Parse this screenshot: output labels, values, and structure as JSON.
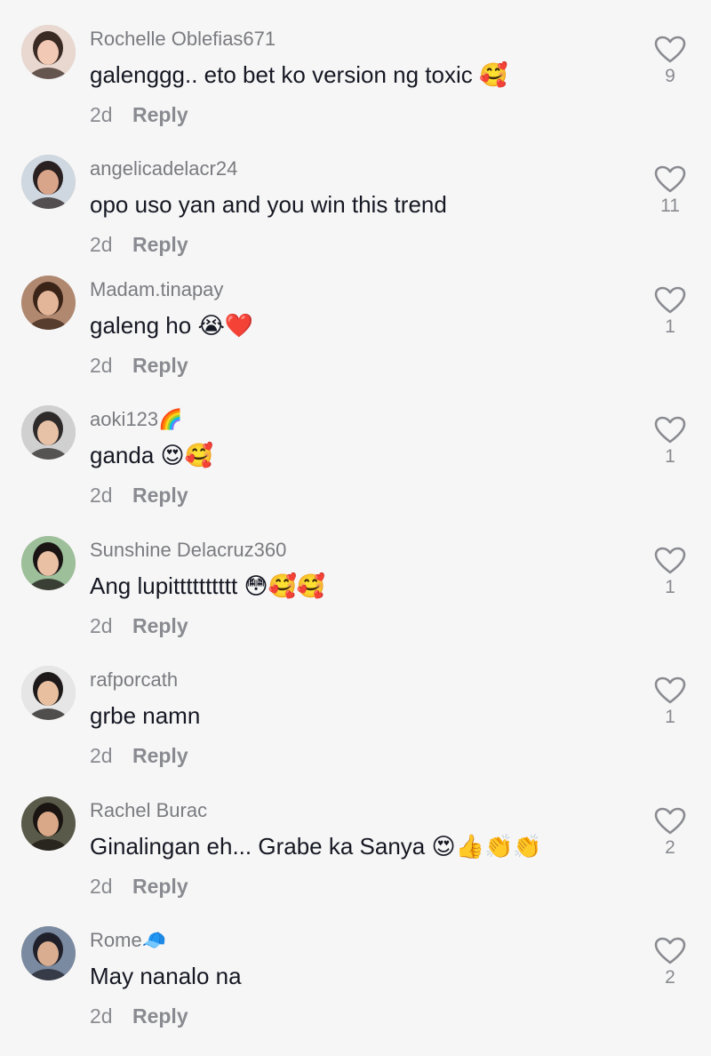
{
  "comments": [
    {
      "username": "Rochelle Oblefias671",
      "username_emoji": "",
      "text": "galenggg.. eto bet ko version ng toxic",
      "emojis": "🥰",
      "time": "2d",
      "reply": "Reply",
      "likes": "9",
      "avatar_colors": [
        "#e8d8d0",
        "#3a2a24",
        "#f1c9b4"
      ]
    },
    {
      "username": "angelicadelacr24",
      "username_emoji": "",
      "text": "opo uso yan and you win this trend",
      "emojis": "",
      "time": "2d",
      "reply": "Reply",
      "likes": "11",
      "avatar_colors": [
        "#cfd8e0",
        "#2a2020",
        "#d9a58a"
      ]
    },
    {
      "username": "Madam.tinapay",
      "username_emoji": "",
      "text": "galeng ho",
      "emojis": "😭❤️",
      "time": "2d",
      "reply": "Reply",
      "likes": "1",
      "avatar_colors": [
        "#b08870",
        "#3a2418",
        "#e3b69a"
      ]
    },
    {
      "username": "aoki123",
      "username_emoji": "🌈",
      "text": "ganda",
      "emojis": "😍🥰",
      "time": "2d",
      "reply": "Reply",
      "likes": "1",
      "avatar_colors": [
        "#d0d0d0",
        "#2e2a2a",
        "#e8c2a6"
      ]
    },
    {
      "username": "Sunshine Delacruz360",
      "username_emoji": "",
      "text": "Ang lupitttttttttt",
      "emojis": "😳🥰🥰",
      "time": "2d",
      "reply": "Reply",
      "likes": "1",
      "avatar_colors": [
        "#9dbf9a",
        "#1a1414",
        "#e9c0a4"
      ]
    },
    {
      "username": "rafporcath",
      "username_emoji": "",
      "text": "grbe namn",
      "emojis": "",
      "time": "2d",
      "reply": "Reply",
      "likes": "1",
      "avatar_colors": [
        "#e6e6e6",
        "#1e1a1a",
        "#e8c0a0"
      ]
    },
    {
      "username": "Rachel Burac",
      "username_emoji": "",
      "text": "Ginalingan eh... Grabe ka Sanya",
      "emojis": "😍👍👏👏",
      "time": "2d",
      "reply": "Reply",
      "likes": "2",
      "avatar_colors": [
        "#5a5a4a",
        "#1a1412",
        "#d8a888"
      ]
    },
    {
      "username": "Rome",
      "username_emoji": "🧢",
      "text": "May nanalo na",
      "emojis": "",
      "time": "2d",
      "reply": "Reply",
      "likes": "2",
      "avatar_colors": [
        "#7a8aa0",
        "#20202a",
        "#d9ae90"
      ]
    }
  ]
}
